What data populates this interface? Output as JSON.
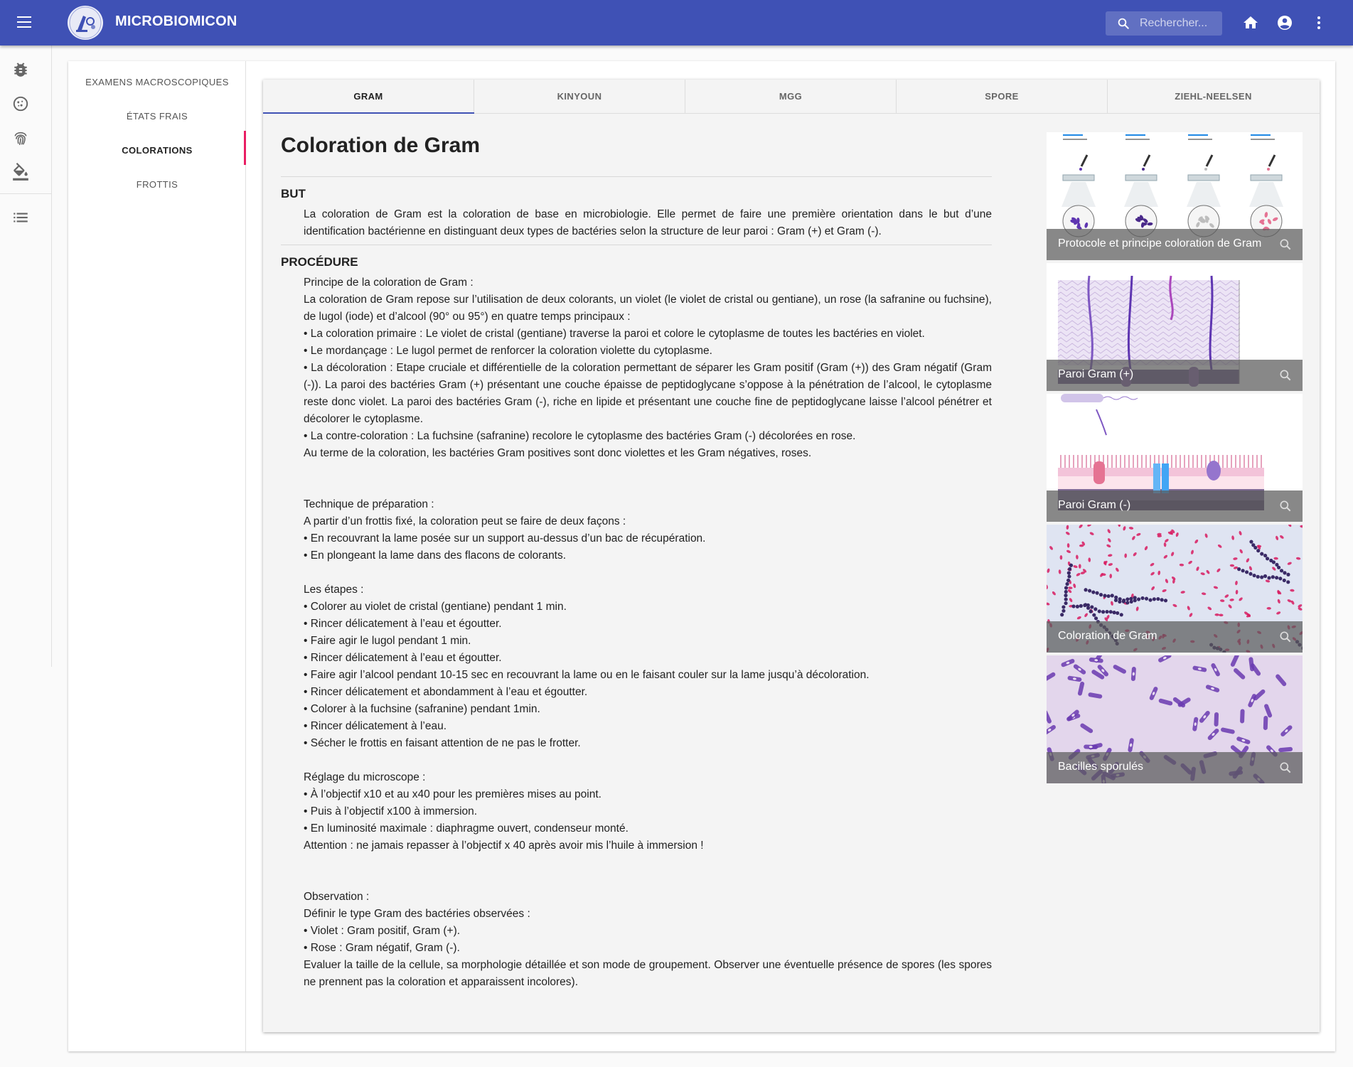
{
  "app": {
    "title": "MICROBIOMICON"
  },
  "search": {
    "placeholder": "Rechercher..."
  },
  "rail": {
    "items": [
      {
        "icon": "bug-icon"
      },
      {
        "icon": "cell-icon"
      },
      {
        "icon": "fingerprint-icon"
      },
      {
        "icon": "paint-bucket-icon"
      },
      {
        "icon": "list-icon"
      }
    ]
  },
  "sidenav": {
    "items": [
      {
        "label": "EXAMENS MACROSCOPIQUES"
      },
      {
        "label": "ÉTATS FRAIS"
      },
      {
        "label": "COLORATIONS"
      },
      {
        "label": "FROTTIS"
      }
    ],
    "active_index": 2
  },
  "tabs": [
    {
      "label": "GRAM"
    },
    {
      "label": "KINYOUN"
    },
    {
      "label": "MGG"
    },
    {
      "label": "SPORE"
    },
    {
      "label": "ZIEHL-NEELSEN"
    }
  ],
  "article": {
    "title": "Coloration de Gram",
    "but_heading": "BUT",
    "but_text": "La coloration de Gram est la coloration de base en microbiologie. Elle permet de faire une première orientation dans le but d’une identification bactérienne en distinguant deux types de bactéries selon la structure de leur paroi : Gram (+) et Gram (-).",
    "procedure_heading": "PROCÉDURE",
    "procedure_lines": [
      "Principe de la coloration de Gram :",
      "La coloration de Gram repose sur l’utilisation de deux colorants, un violet (le violet de cristal ou gentiane), un rose (la safranine ou fuchsine), de lugol (iode) et d’alcool (90° ou 95°) en quatre temps principaux :",
      "• La coloration primaire : Le violet de cristal (gentiane) traverse la paroi et colore le cytoplasme de toutes les bactéries en violet.",
      "• Le mordançage : Le lugol permet de renforcer la coloration violette du cytoplasme.",
      "• La décoloration : Etape cruciale et différentielle de la coloration permettant de séparer les Gram positif (Gram (+)) des Gram négatif (Gram (-)). La paroi des bactéries Gram (+) présentant une couche épaisse de peptidoglycane s’oppose à la pénétration de l’alcool, le cytoplasme reste donc violet. La paroi des bactéries Gram (-), riche en lipide et présentant une couche fine de peptidoglycane laisse l’alcool pénétrer et décolorer le cytoplasme.",
      "• La contre-coloration : La fuchsine (safranine) recolore le cytoplasme des bactéries Gram (-) décolorées en rose.",
      "Au terme de la coloration, les bactéries Gram positives sont donc violettes et les Gram négatives, roses.",
      "",
      "",
      "Technique de préparation :",
      "A partir d’un frottis fixé, la coloration peut se faire de deux façons :",
      "• En recouvrant la lame posée sur un support au-dessus d’un bac de récupération.",
      "• En plongeant la lame dans des flacons de colorants.",
      "",
      "Les étapes :",
      "• Colorer au violet de cristal (gentiane) pendant 1 min.",
      "• Rincer délicatement à l’eau et égoutter.",
      "• Faire agir le lugol pendant 1 min.",
      "• Rincer délicatement à l’eau et égoutter.",
      "• Faire agir l’alcool pendant 10-15 sec en recouvrant la lame ou en le faisant couler sur la lame jusqu’à décoloration.",
      "• Rincer délicatement et abondamment à l’eau et égoutter.",
      "• Colorer à la fuchsine (safranine) pendant 1min.",
      "• Rincer délicatement à l’eau.",
      "• Sécher le frottis en faisant attention de ne pas le frotter.",
      "",
      "Réglage du microscope :",
      "• À l’objectif x10 et au x40 pour les premières mises au point.",
      "• Puis à l’objectif x100 à immersion.",
      "• En luminosité maximale : diaphragme ouvert, condenseur monté.",
      "Attention : ne jamais repasser à l’objectif x 40 après avoir mis l’huile à immersion !",
      "",
      "",
      "Observation :",
      "Définir le type Gram des bactéries observées :",
      "• Violet : Gram positif, Gram (+).",
      "• Rose : Gram négatif, Gram (-).",
      "Evaluer la taille de la cellule, sa morphologie détaillée et son mode de groupement. Observer une éventuelle présence de spores (les spores ne prennent pas la coloration et apparaissent incolores)."
    ]
  },
  "gallery": [
    {
      "caption": "Protocole et principe coloration de Gram",
      "icon": "zoom-icon"
    },
    {
      "caption": "Paroi Gram (+)",
      "icon": "zoom-icon"
    },
    {
      "caption": "Paroi Gram (-)",
      "icon": "zoom-icon"
    },
    {
      "caption": "Coloration de Gram",
      "icon": "zoom-icon"
    },
    {
      "caption": "Bacilles sporulés",
      "icon": "zoom-icon"
    }
  ],
  "colors": {
    "primary": "#3f51b5",
    "accent": "#e91e63"
  }
}
